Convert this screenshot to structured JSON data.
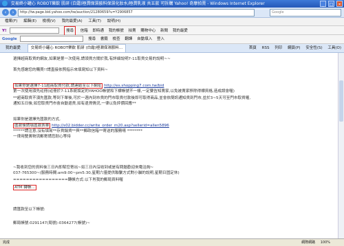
{
  "window": {
    "title": "交易終小罐心 ROBOT樂飲 肌研 (白霜)極潤保濕胺料保濕化妝水/極潤乳液 共五款 可拆購 Yahoo! 奇摩拍賣 - Windows Internet Explorer",
    "controls": [
      "_",
      "□",
      "×"
    ]
  },
  "address_bar": {
    "url": "http://tw.page.bid.yahoo.com/tw/auction/21280659?u=Y2906857",
    "search_placeholder": "Google"
  },
  "menu": [
    "檔案(F)",
    "編輯(E)",
    "檢視(V)",
    "我的最愛(A)",
    "工具(T)",
    "說明(H)"
  ],
  "yahoo_toolbar": {
    "logo": "Y!",
    "buttons": [
      "搜尋",
      "信箱",
      "即時通",
      "我的帳號",
      "拍賣",
      "購物中心",
      "新聞",
      "我的最愛"
    ],
    "highlighted": "搜尋"
  },
  "google_toolbar": {
    "logo": "Google",
    "buttons": [
      "搜尋",
      "書籤",
      "檢查",
      "翻譯",
      "自動填入",
      "登入"
    ]
  },
  "tabs": {
    "items": [
      "我的最愛",
      "交易終小罐心 ROBOT樂飲 肌研 (白霜)極潤保濕胺料..."
    ],
    "tools": [
      "首頁",
      "RSS",
      "列印",
      "網頁(P)",
      "安全性(S)",
      "工具(O)"
    ]
  },
  "content": {
    "lines": [
      "選擇超商取貨的網友,如果是第一次使用,請領貨方關於我,有詳細說明7-11取貨交易的說明~~",
      "首先感謝您的購買!!請直接依照指示來填寫知以下資料~",
      "如果你是選擇7-11超商取貨付款,請連結至以下網址",
      "http://es.shopping7.com.tw/bid",
      "第一次使用須先註冊(註冊於7-11系統設定的YAHOO帳號和下標帳號不一樣,一定要告知賣家,以免被賣家移除得標資格,造成誤會喔)",
      "**超商取貨不須先匯款,等到下單後,可於一週內到市貨的門市取貨付款後即可取得商品,並會依簡訊通知貨到門市,並於3~5天可至門市取貨喔,",
      "通知五日後,如您取貨門市會自動退貨,如有退貨情況,一律以負評價回應**",
      "如果你是選擇先匯款的方式,",
      "匯款後請填匯款表單",
      "http://s02.bidder.cc/write_order_m20.asp?sellerid=allen5896",
      "******請注意,沒有填寫**存貨銷貨**與**郵政信箱**寄送的服務唷 ********",
      "一律用雙黃物流郵寄請您耐心等待",
      "~我收到您的資料後三日內即幫您寄出~如三日內沒收到或是有問題歡迎來電洽詢~",
      "037-765300~(服務時間:am9:00~pm5:30,星期六僅提供聯繫方式對小貓的說明,星期日固定休)",
      "=================轉帳方式:以下肖我的郵局資料喔",
      "ATM 轉帳...",
      "請匯款至以下帳號:",
      "郵局帳號:0291147(局號)-0364277(帳號)~"
    ]
  },
  "status": {
    "left": "完成",
    "zone": "網際網路",
    "zoom": "100%"
  }
}
